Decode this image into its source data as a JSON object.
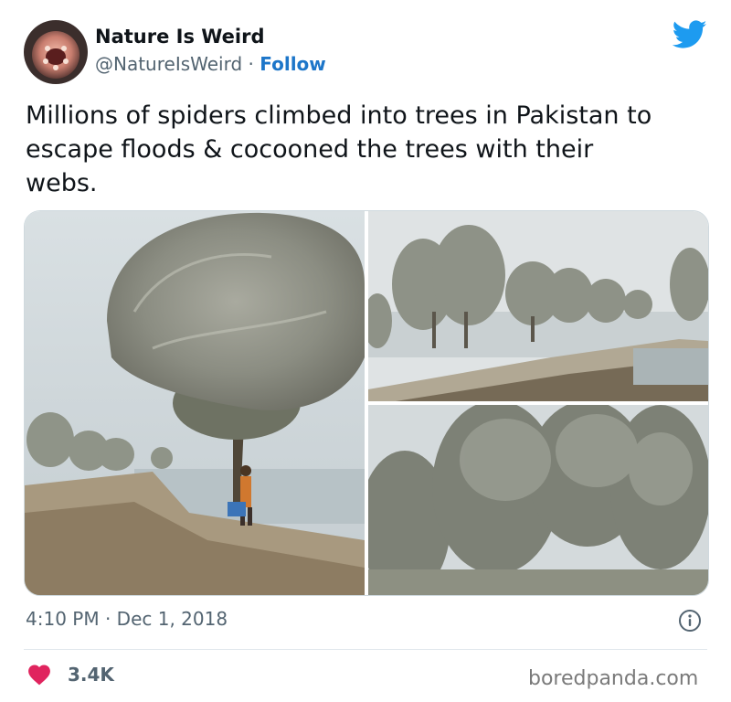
{
  "author": {
    "display_name": "Nature Is Weird",
    "handle": "@NatureIsWeird",
    "separator": "·",
    "follow_label": "Follow",
    "avatar_icon": "avatar-icon"
  },
  "brand": {
    "logo_icon": "twitter-bird-icon",
    "color": "#1d9bf0"
  },
  "tweet": {
    "text": "Millions of spiders climbed into trees in Pakistan to\nescape floods & cocooned the trees with their\nwebs.",
    "photos": [
      "photo-1",
      "photo-2",
      "photo-3"
    ]
  },
  "meta": {
    "time": "4:10 PM",
    "separator": "·",
    "date": "Dec 1, 2018",
    "info_icon": "info-icon"
  },
  "engagement": {
    "like_icon": "heart-icon",
    "like_color": "#e0245e",
    "likes": "3.4K"
  },
  "watermark": "boredpanda.com"
}
